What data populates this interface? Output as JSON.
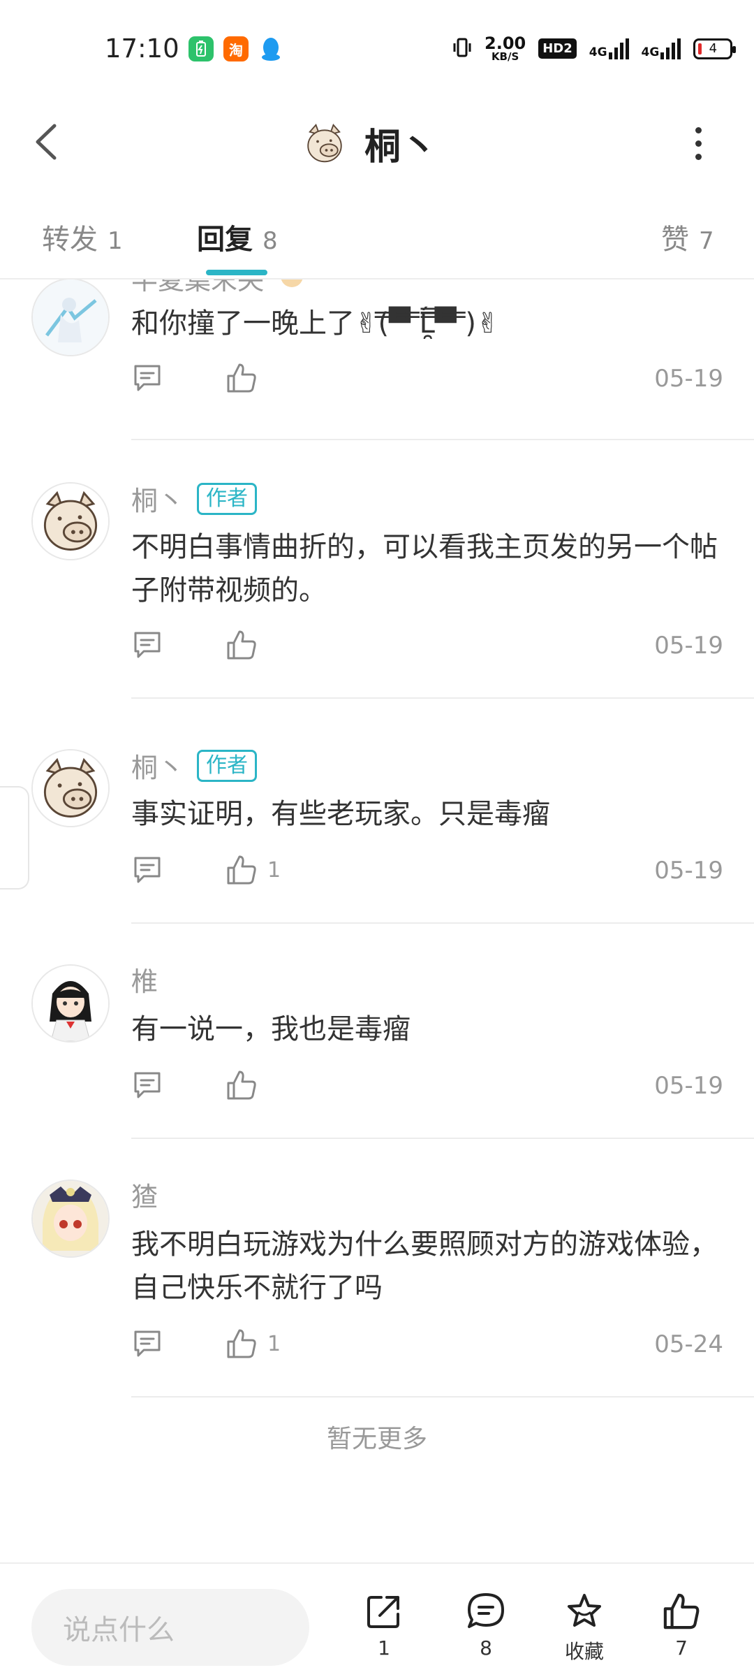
{
  "status_bar": {
    "time": "17:10",
    "net_speed_value": "2.00",
    "net_speed_unit": "KB/S",
    "hd_label": "HD2",
    "signal1_label": "4G",
    "signal2_label": "4G",
    "battery_level": "4",
    "app_icons": [
      {
        "name": "battery-app-icon",
        "color": "#2dc26b"
      },
      {
        "name": "taobao-app-icon",
        "color": "#ff6a00",
        "label": "淘"
      },
      {
        "name": "qq-app-icon",
        "color": "#1e9bf0"
      }
    ]
  },
  "header": {
    "title": "桐丶"
  },
  "tabs": [
    {
      "label": "转发",
      "count": "1"
    },
    {
      "label": "回复",
      "count": "8"
    },
    {
      "label": "赞",
      "count": "7"
    }
  ],
  "comments": [
    {
      "username": "半夏葉末央",
      "is_author": false,
      "text": "和你撞了一晚上了✌(̿▀̿ ̿Ĺ̯̿̿▀̿ ̿)✌",
      "likes": "",
      "date": "05-19"
    },
    {
      "username": "桐丶",
      "is_author": true,
      "text": "不明白事情曲折的，可以看我主页发的另一个帖子附带视频的。",
      "likes": "",
      "date": "05-19"
    },
    {
      "username": "桐丶",
      "is_author": true,
      "text": "事实证明，有些老玩家。只是毒瘤",
      "likes": "1",
      "date": "05-19"
    },
    {
      "username": "椎",
      "is_author": false,
      "text": "有一说一，我也是毒瘤",
      "likes": "",
      "date": "05-19"
    },
    {
      "username": "猹",
      "is_author": false,
      "text": "我不明白玩游戏为什么要照顾对方的游戏体验，自己快乐不就行了吗",
      "likes": "1",
      "date": "05-24"
    }
  ],
  "author_badge": "作者",
  "no_more": "暂无更多",
  "bottom_bar": {
    "input_placeholder": "说点什么",
    "share_count": "1",
    "comment_count": "8",
    "favorite_label": "收藏",
    "like_count": "7"
  },
  "colors": {
    "accent": "#2bb5c6",
    "muted_text": "#999999"
  }
}
